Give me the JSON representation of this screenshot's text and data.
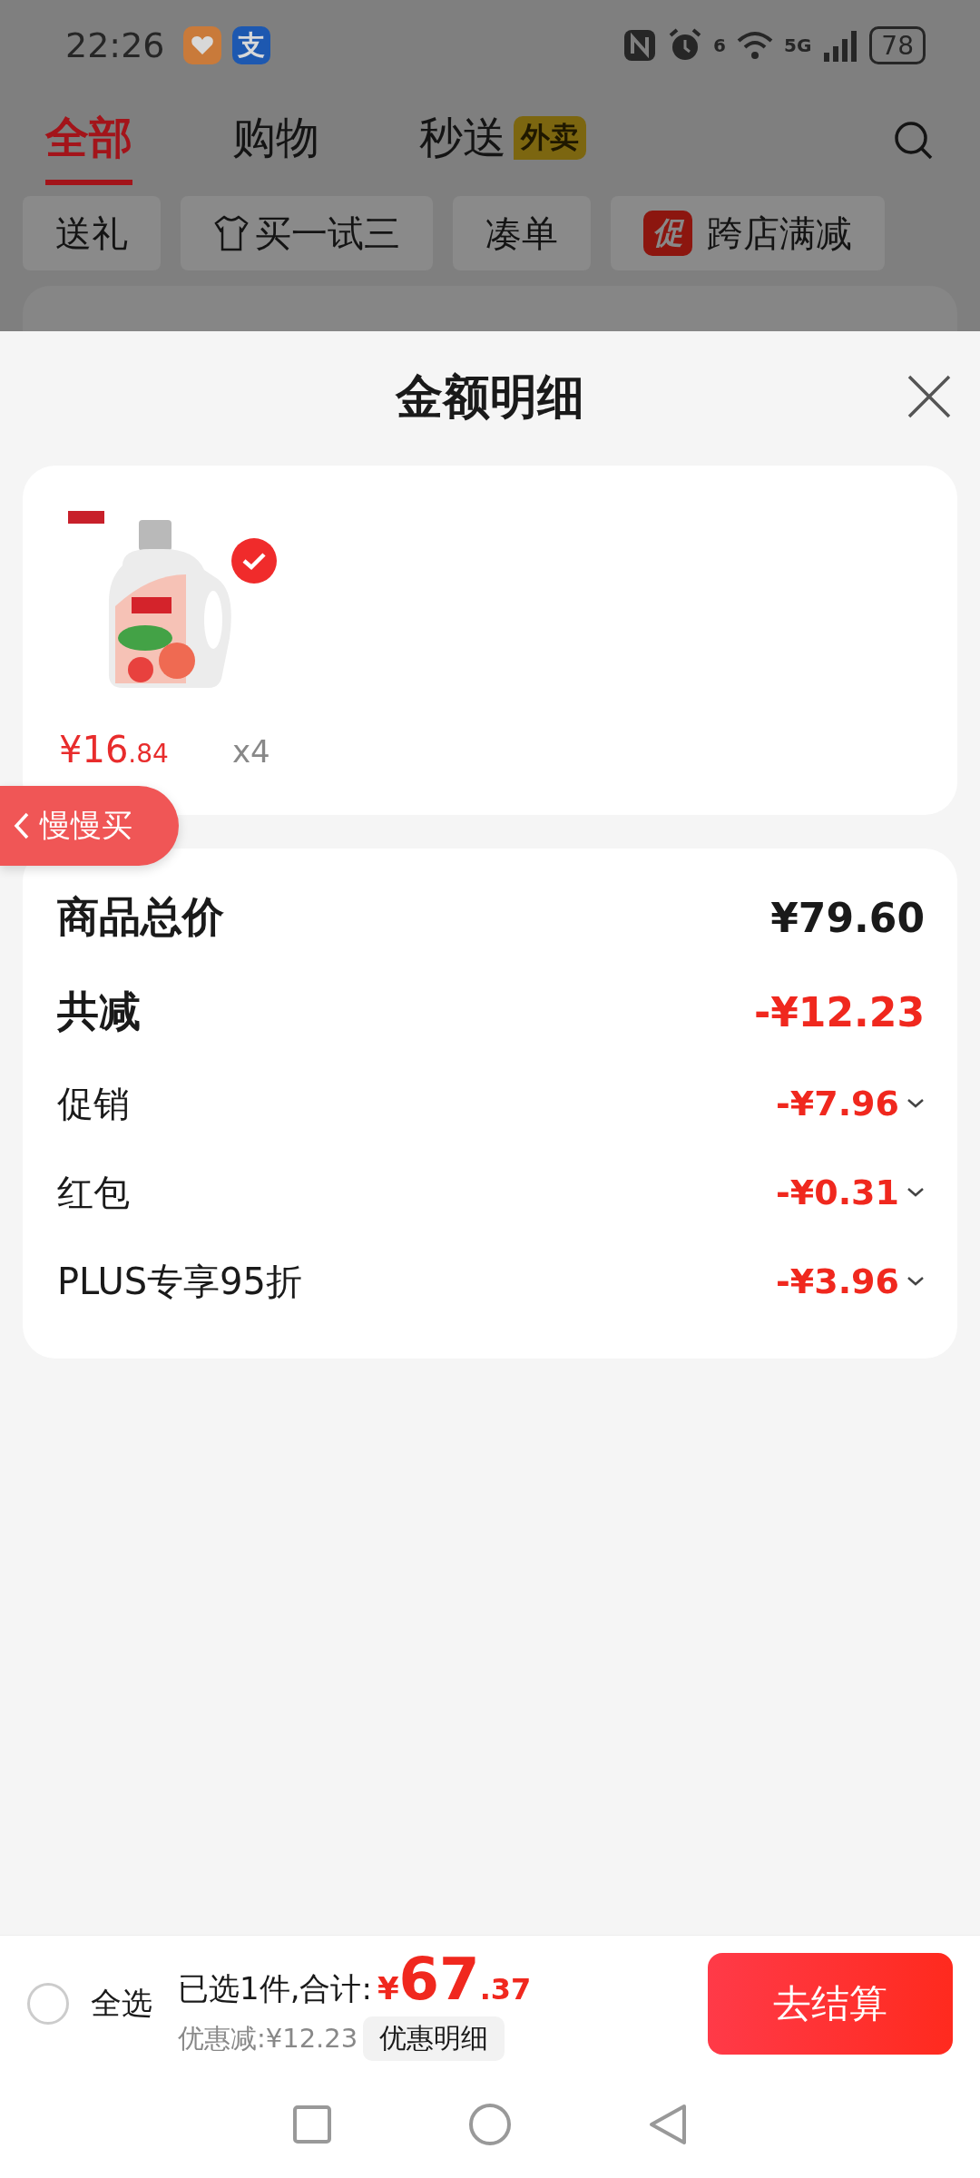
{
  "status_bar": {
    "time": "22:26",
    "alipay_glyph": "支",
    "wifi_label": "6",
    "network_label": "5G",
    "battery": "78"
  },
  "tabs": [
    {
      "label": "全部",
      "selected": true
    },
    {
      "label": "购物",
      "selected": false
    },
    {
      "label": "秒送",
      "selected": false,
      "badge": "外卖"
    }
  ],
  "chips": [
    {
      "label": "送礼",
      "kind": "plain"
    },
    {
      "label": "买一试三",
      "kind": "shirt"
    },
    {
      "label": "凑单",
      "kind": "plain"
    },
    {
      "label": "跨店满减",
      "kind": "promo",
      "tag": "促"
    }
  ],
  "sheet": {
    "title": "金额明细",
    "product": {
      "kind": "picture",
      "checked": true,
      "price_main": "¥16",
      "price_decimal": ".84",
      "quantity": "x4"
    },
    "summary": [
      {
        "kind": "total",
        "label": "商品总价",
        "amount": "¥79.60"
      },
      {
        "kind": "discount_total",
        "label": "共减",
        "amount": "-¥12.23"
      },
      {
        "kind": "detail",
        "label": "促销",
        "amount": "-¥7.96"
      },
      {
        "kind": "detail",
        "label": "红包",
        "amount": "-¥0.31"
      },
      {
        "kind": "detail",
        "label": "PLUS专享95折",
        "amount": "-¥3.96"
      }
    ]
  },
  "floating_button": {
    "label": "慢慢买"
  },
  "bottom_bar": {
    "select_all": {
      "label": "全选",
      "checked": false
    },
    "selected_text": "已选1件,合计:",
    "currency": "¥",
    "total_main": "67",
    "total_decimal": ".37",
    "discount_text": "优惠减:¥12.23",
    "detail_button": "优惠明细",
    "checkout_button": "去结算"
  }
}
